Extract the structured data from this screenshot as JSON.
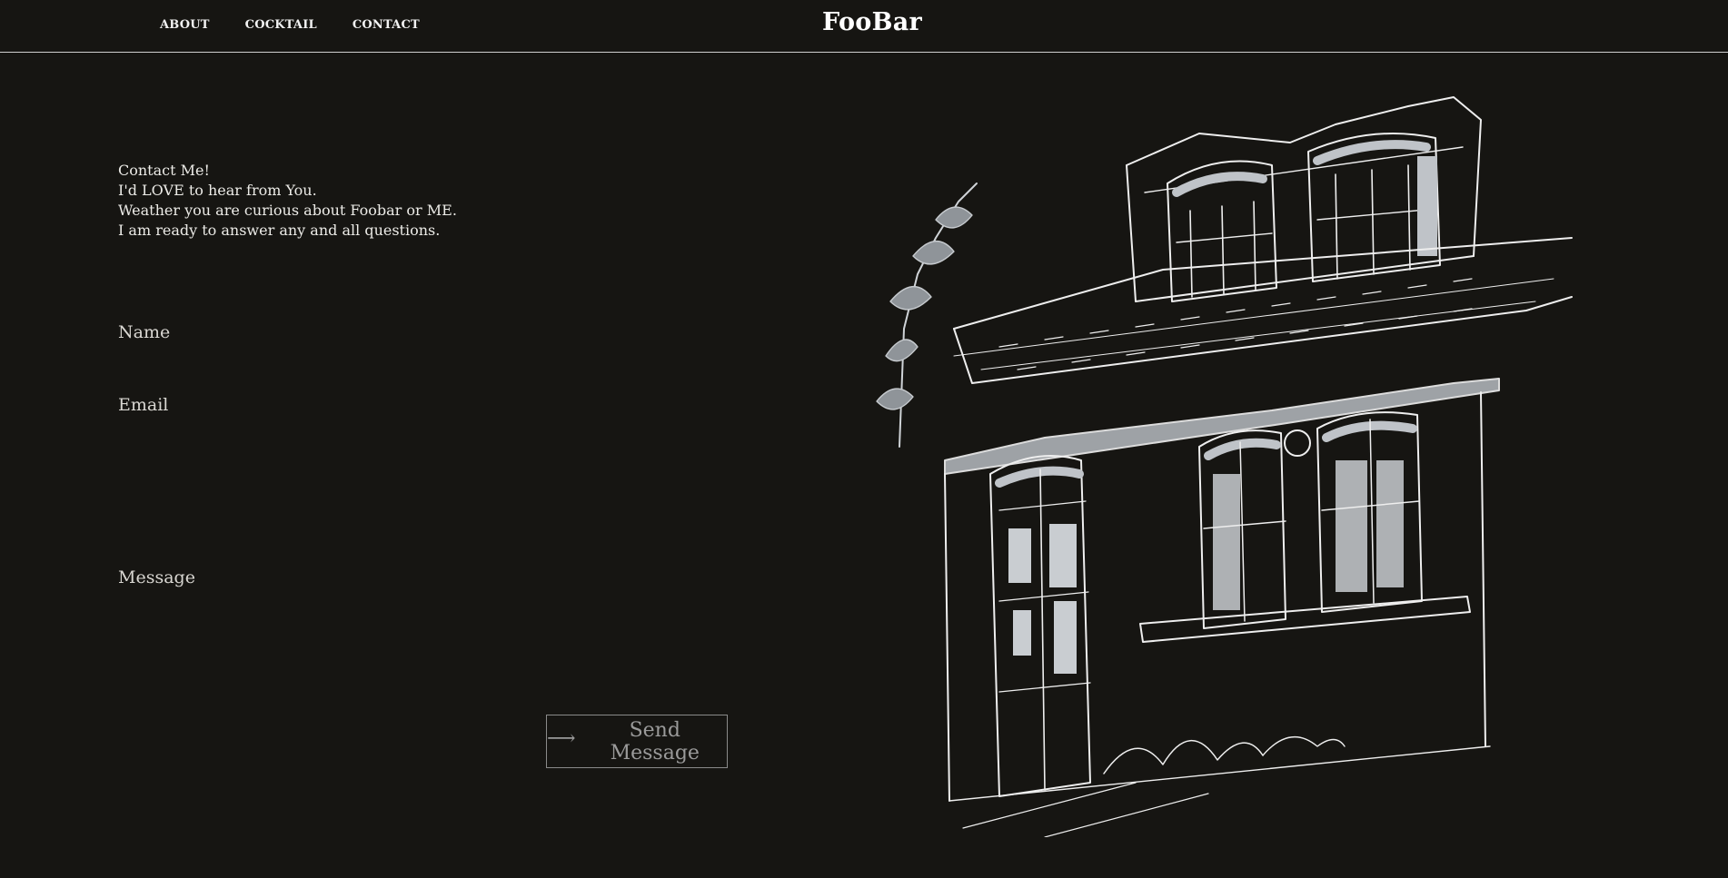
{
  "nav": {
    "items": [
      "ABOUT",
      "COCKTAIL",
      "CONTACT"
    ]
  },
  "brand": "FooBar",
  "intro": {
    "lines": [
      "Contact Me!",
      "I'd LOVE to hear from You.",
      "Weather you are curious about Foobar or ME.",
      "I am ready to answer any and all questions."
    ]
  },
  "form": {
    "name_label": "Name",
    "email_label": "Email",
    "message_label": "Message",
    "send_label": "Send Message",
    "send_icon": "right-arrow-icon"
  },
  "illustration": {
    "description_icon": "building-sketch-image"
  },
  "colors": {
    "background": "#161512",
    "text": "#e8e6e1",
    "button_text": "#9a9a9a",
    "button_border": "#8a8a8a"
  }
}
